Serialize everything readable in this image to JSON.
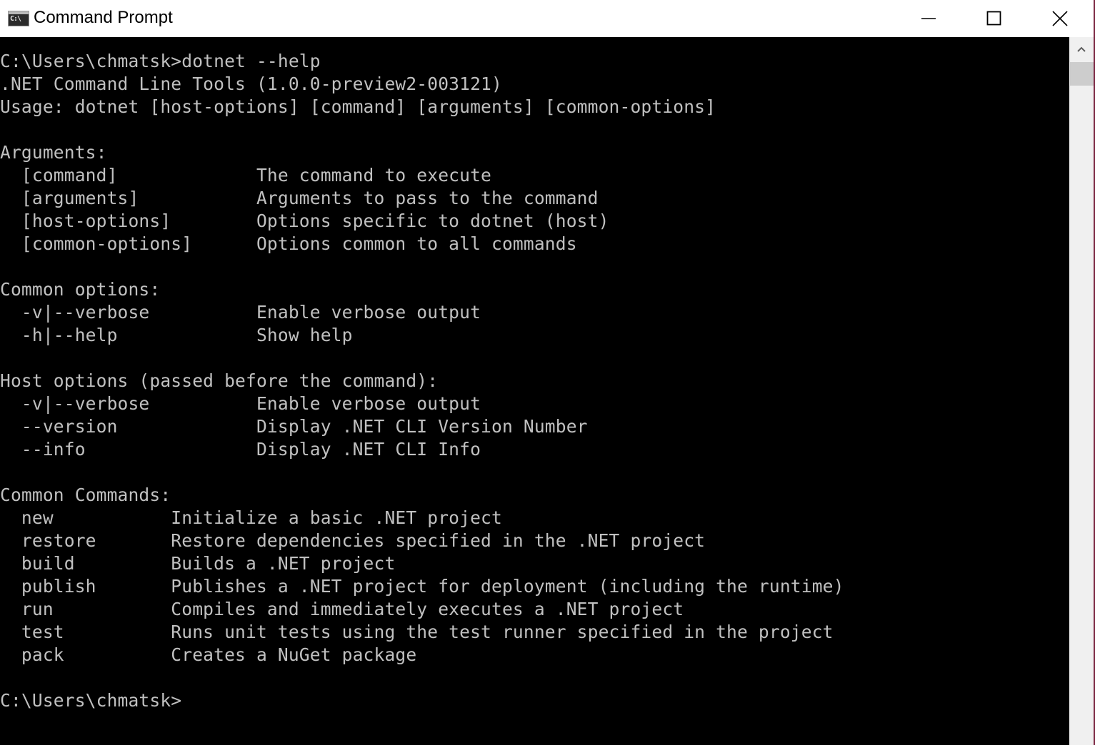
{
  "window": {
    "title": "Command Prompt",
    "icon_text": "C:\\",
    "controls": {
      "minimize": "minimize-icon",
      "maximize": "maximize-icon",
      "close": "close-icon"
    }
  },
  "console": {
    "lines": [
      "",
      "C:\\Users\\chmatsk>dotnet --help",
      ".NET Command Line Tools (1.0.0-preview2-003121)",
      "Usage: dotnet [host-options] [command] [arguments] [common-options]",
      "",
      "Arguments:",
      "  [command]             The command to execute",
      "  [arguments]           Arguments to pass to the command",
      "  [host-options]        Options specific to dotnet (host)",
      "  [common-options]      Options common to all commands",
      "",
      "Common options:",
      "  -v|--verbose          Enable verbose output",
      "  -h|--help             Show help",
      "",
      "Host options (passed before the command):",
      "  -v|--verbose          Enable verbose output",
      "  --version             Display .NET CLI Version Number",
      "  --info                Display .NET CLI Info",
      "",
      "Common Commands:",
      "  new           Initialize a basic .NET project",
      "  restore       Restore dependencies specified in the .NET project",
      "  build         Builds a .NET project",
      "  publish       Publishes a .NET project for deployment (including the runtime)",
      "  run           Compiles and immediately executes a .NET project",
      "  test          Runs unit tests using the test runner specified in the project",
      "  pack          Creates a NuGet package",
      "",
      "C:\\Users\\chmatsk>"
    ]
  },
  "colors": {
    "console_bg": "#000000",
    "console_fg": "#c0c0c0",
    "window_border": "#7a2440"
  }
}
